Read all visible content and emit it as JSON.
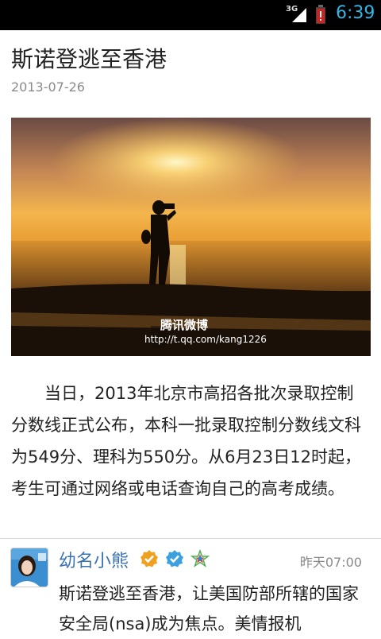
{
  "status_bar": {
    "network": "3G",
    "time": "6:39",
    "icons": [
      "signal-icon",
      "battery-warning-icon"
    ],
    "time_color": "#33b5e5"
  },
  "article": {
    "title": "斯诺登逃至香港",
    "date": "2013-07-26",
    "image": {
      "watermark_brand": "腾讯微博",
      "watermark_url": "http://t.qq.com/kang1226"
    },
    "body": "当日，2013年北京市高招各批次录取控制分数线正式公布，本科一批录取控制分数线文科为549分、理科为550分。从6月23日12时起，考生可通过网络或电话查询自己的高考成绩。"
  },
  "comment": {
    "username": "幼名小熊",
    "badges": [
      "gold-verified-badge-icon",
      "blue-verified-badge-icon",
      "star-badge-icon"
    ],
    "time": "昨天07:00",
    "text": "斯诺登逃至香港，让美国防部所辖的国家安全局(nsa)成为焦点。美情报机"
  },
  "colors": {
    "link_blue": "#3a72b0",
    "muted": "#8a8a8a",
    "accent": "#33b5e5"
  }
}
